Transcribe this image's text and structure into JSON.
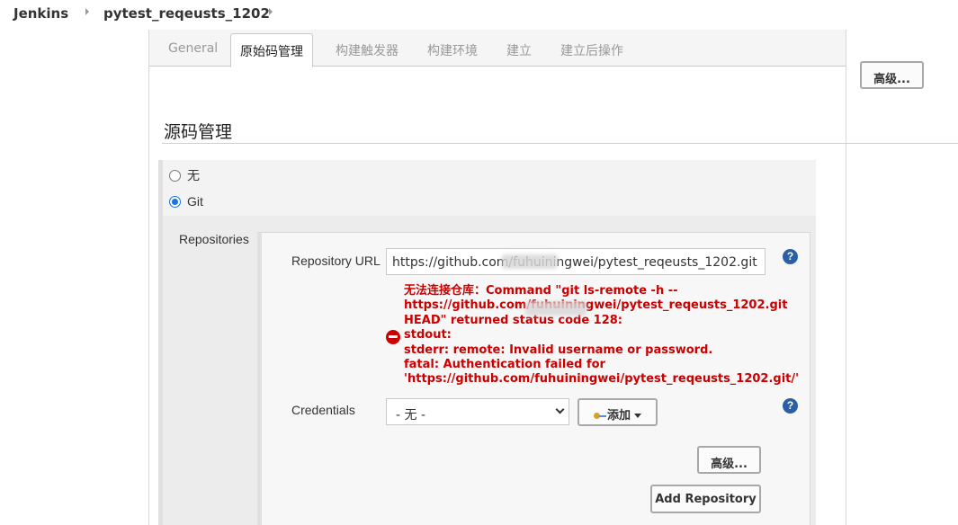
{
  "breadcrumb": {
    "items": [
      "Jenkins",
      "pytest_reqeusts_1202"
    ]
  },
  "tabs": [
    {
      "label": "General"
    },
    {
      "label": "原始码管理"
    },
    {
      "label": "构建触发器"
    },
    {
      "label": "构建环境"
    },
    {
      "label": "建立"
    },
    {
      "label": "建立后操作"
    }
  ],
  "advanced_top_label": "高级...",
  "scm": {
    "title": "源码管理",
    "options": [
      {
        "label": "无",
        "checked": false
      },
      {
        "label": "Git",
        "checked": true
      }
    ]
  },
  "repositories": {
    "label": "Repositories",
    "url_label": "Repository URL",
    "url_value": "https://github.com/fuhuiningwei/pytest_reqeusts_1202.git",
    "error": "无法连接仓库：Command \"git ls-remote -h --\nhttps://github.com/fuhuiningwei/pytest_reqeusts_1202.git\nHEAD\" returned status code 128:\nstdout:\nstderr: remote: Invalid username or password.\nfatal: Authentication failed for\n'https://github.com/fuhuiningwei/pytest_reqeusts_1202.git/'",
    "credentials_label": "Credentials",
    "credentials_value": "- 无 -",
    "add_label": "添加",
    "advanced_label": "高级...",
    "add_repository_label": "Add Repository"
  },
  "colors": {
    "error": "#cc0000",
    "help": "#2a5fa5",
    "radio_checked": "#1a73e8"
  },
  "icons": [
    "chevron-right-icon",
    "help-icon",
    "error-icon",
    "key-icon",
    "caret-down-icon"
  ]
}
